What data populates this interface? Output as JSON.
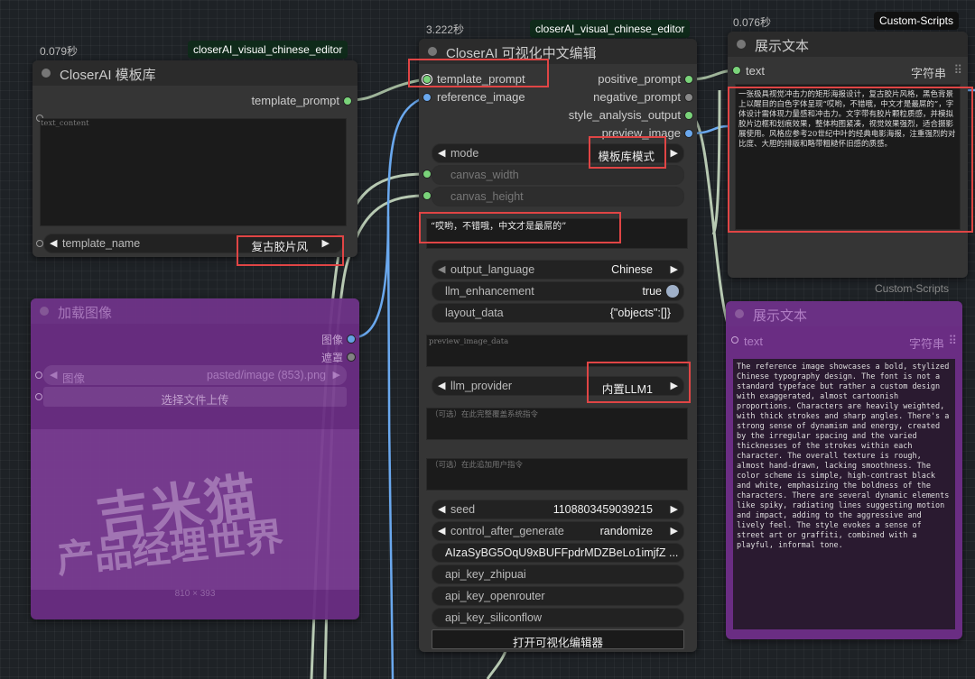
{
  "templates_node": {
    "time": "0.079秒",
    "badge": "closerAI_visual_chinese_editor",
    "title": "CloserAI 模板库",
    "output_label": "template_prompt",
    "textarea_placeholder": "text_content",
    "template_name_label": "template_name",
    "template_name_value": "复古胶片风"
  },
  "load_image_node": {
    "title": "加载图像",
    "out_image": "图像",
    "out_mask": "遮罩",
    "image_label": "图像",
    "image_value": "pasted/image (853).png",
    "upload_label": "选择文件上传",
    "image_text_line1": "吉米猫",
    "image_text_line2": "产品经理世界",
    "image_size": "810 × 393"
  },
  "editor_node": {
    "time": "3.222秒",
    "badge": "closerAI_visual_chinese_editor",
    "title": "CloserAI 可视化中文编辑",
    "in_template_prompt": "template_prompt",
    "in_reference_image": "reference_image",
    "out_positive": "positive_prompt",
    "out_negative": "negative_prompt",
    "out_style": "style_analysis_output",
    "out_preview": "preview_image",
    "mode_label": "mode",
    "mode_value": "模板库模式",
    "canvas_width": "canvas_width",
    "canvas_height": "canvas_height",
    "text_input": "“哎哟，不错哦，中文才是最屌的”",
    "output_language_label": "output_language",
    "output_language_value": "Chinese",
    "llm_enhancement_label": "llm_enhancement",
    "llm_enhancement_value": "true",
    "layout_data_label": "layout_data",
    "layout_data_value": "{\"objects\":[]}",
    "preview_image_data": "preview_image_data",
    "llm_provider_label": "llm_provider",
    "llm_provider_value": "内置LLM1",
    "system_prompt_placeholder": "（可选）在此完整覆盖系统指令",
    "user_prompt_placeholder": "（可选）在此追加用户指令",
    "seed_label": "seed",
    "seed_value": "1108803459039215",
    "control_label": "control_after_generate",
    "control_value": "randomize",
    "api_key_value": "AIzaSyBG5OqU9xBUFFpdrMDZBeLo1imjfZ ...",
    "api_key_zhipuai": "api_key_zhipuai",
    "api_key_openrouter": "api_key_openrouter",
    "api_key_siliconflow": "api_key_siliconflow",
    "open_button": "打开可视化编辑器"
  },
  "show_text_node_1": {
    "time": "0.076秒",
    "badge": "Custom-Scripts",
    "title": "展示文本",
    "input_label": "text",
    "input_type": "字符串",
    "content": "一张极具视觉冲击力的矩形海报设计，复古胶片风格，黑色背景上以醒目的白色字体呈现“哎哟，不错哦，中文才是最屌的”，字体设计需体现力量感和冲击力。文字带有胶片颗粒质感，并模拟胶片边框和划痕效果，整体构图紧凑，视觉效果强烈，适合摄影展使用。风格应参考20世纪中叶的经典电影海报，注重强烈的对比度、大胆的排版和略带粗糙怀旧感的质感。"
  },
  "show_text_node_2": {
    "badge": "Custom-Scripts",
    "title": "展示文本",
    "input_label": "text",
    "input_type": "字符串",
    "content": "The reference image showcases a bold, stylized Chinese typography design. The font is not a standard typeface but rather a custom design with exaggerated, almost cartoonish proportions. Characters are heavily weighted, with thick strokes and sharp angles. There's a strong sense of dynamism and energy, created by the irregular spacing and the varied thicknesses of the strokes within each character. The overall texture is rough, almost hand-drawn, lacking smoothness. The color scheme is simple, high-contrast black and white, emphasizing the boldness of the characters. There are several dynamic elements like spiky, radiating lines suggesting motion and impact, adding to the aggressive and lively feel. The style evokes a sense of street art or graffiti, combined with a playful, informal tone."
  },
  "colors": {
    "accent_red": "#e04545",
    "link_green": "#9fb59a",
    "link_blue": "#6aa8ee",
    "purple_node": "#6a2d83"
  }
}
